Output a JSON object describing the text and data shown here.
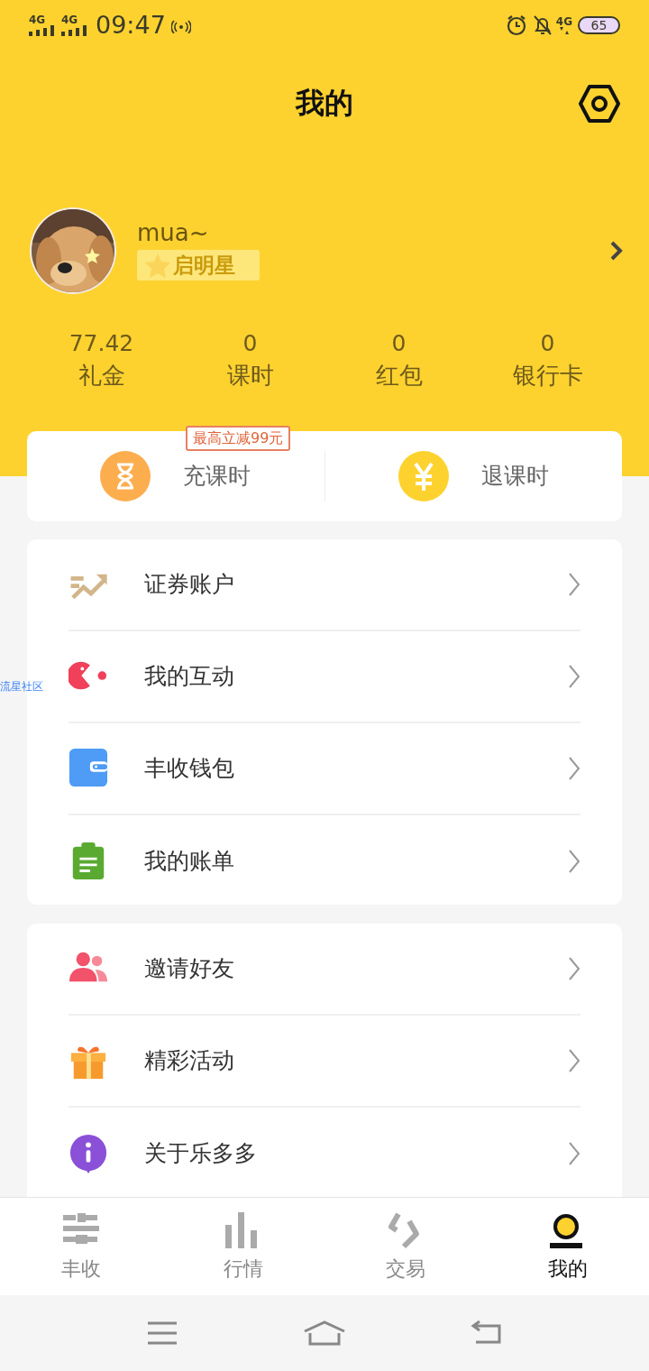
{
  "status_bar": {
    "network_labels": [
      "4G",
      "4G"
    ],
    "time": "09:47",
    "right_network": "4G",
    "battery": "65"
  },
  "header": {
    "title": "我的"
  },
  "profile": {
    "name": "mua~",
    "badge": "启明星"
  },
  "stats": [
    {
      "value": "77.42",
      "label": "礼金"
    },
    {
      "value": "0",
      "label": "课时"
    },
    {
      "value": "0",
      "label": "红包"
    },
    {
      "value": "0",
      "label": "银行卡"
    }
  ],
  "actions": [
    {
      "kind": "hourglass",
      "label": "充课时",
      "tag": "最高立减99元"
    },
    {
      "kind": "yen",
      "label": "退课时"
    }
  ],
  "menu_groups": [
    [
      {
        "kind": "trend",
        "label": "证券账户"
      },
      {
        "kind": "pacman",
        "label": "我的互动"
      },
      {
        "kind": "wallet",
        "label": "丰收钱包"
      },
      {
        "kind": "bill",
        "label": "我的账单"
      }
    ],
    [
      {
        "kind": "friends",
        "label": "邀请好友"
      },
      {
        "kind": "gift",
        "label": "精彩活动"
      },
      {
        "kind": "info",
        "label": "关于乐多多"
      }
    ]
  ],
  "floating_link": "流星社区",
  "tabs": [
    {
      "kind": "sliders",
      "label": "丰收",
      "selected": false
    },
    {
      "kind": "bars",
      "label": "行情",
      "selected": false
    },
    {
      "kind": "trade",
      "label": "交易",
      "selected": false
    },
    {
      "kind": "me",
      "label": "我的",
      "selected": true
    }
  ]
}
